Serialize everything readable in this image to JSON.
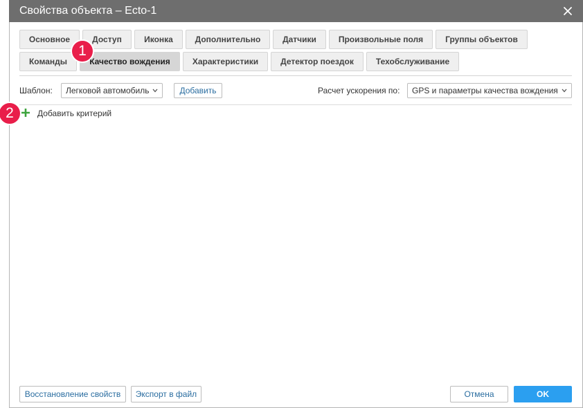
{
  "window": {
    "title": "Свойства объекта – Ecto-1",
    "close_icon": "close-icon"
  },
  "tabs": [
    {
      "label": "Основное",
      "active": false
    },
    {
      "label": "Доступ",
      "active": false
    },
    {
      "label": "Иконка",
      "active": false
    },
    {
      "label": "Дополнительно",
      "active": false
    },
    {
      "label": "Датчики",
      "active": false
    },
    {
      "label": "Произвольные поля",
      "active": false
    },
    {
      "label": "Группы объектов",
      "active": false
    },
    {
      "label": "Команды",
      "active": false
    },
    {
      "label": "Качество вождения",
      "active": true
    },
    {
      "label": "Характеристики",
      "active": false
    },
    {
      "label": "Детектор поездок",
      "active": false
    },
    {
      "label": "Техобслуживание",
      "active": false
    }
  ],
  "toolbar": {
    "template_label": "Шаблон:",
    "template_value": "Легковой автомобиль",
    "add_button": "Добавить",
    "acceleration_label": "Расчет ускорения по:",
    "acceleration_value": "GPS и параметры качества вождения"
  },
  "criteria": {
    "add_label": "Добавить критерий",
    "add_icon": "plus-icon"
  },
  "annotations": {
    "badge_1": "1",
    "badge_2": "2"
  },
  "footer": {
    "restore_button": "Восстановление свойств",
    "export_button": "Экспорт в файл",
    "cancel_button": "Отмена",
    "ok_button": "OK"
  },
  "colors": {
    "titlebar": "#6e6e6e",
    "active_tab": "#d6d6d6",
    "link_text": "#2a6da0",
    "ok_button": "#2b9ff0",
    "plus_icon": "#3ca33c",
    "badge": "#e91e4a"
  }
}
